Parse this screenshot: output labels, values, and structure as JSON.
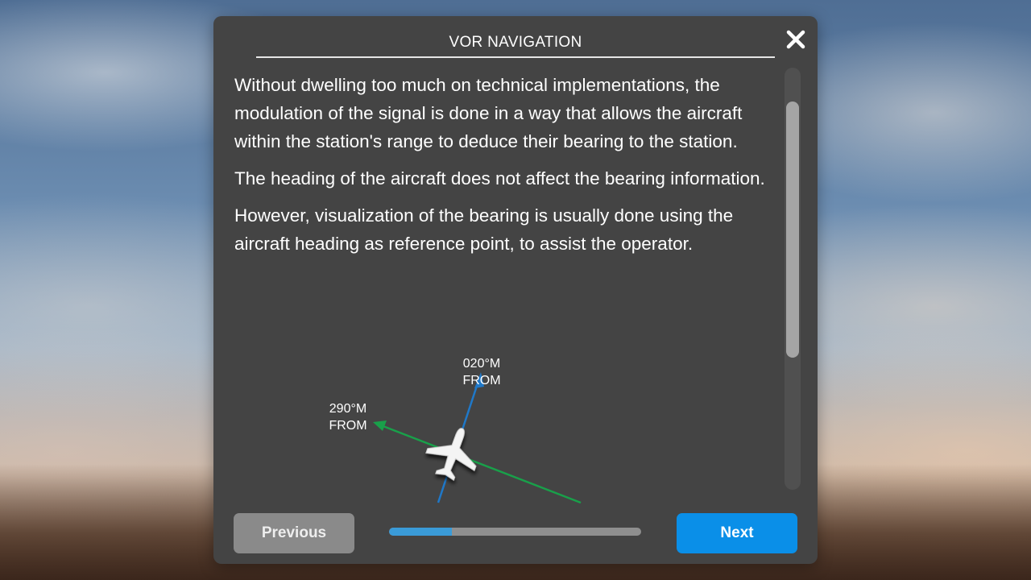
{
  "dialog": {
    "title": "VOR NAVIGATION",
    "close_icon": "close-icon"
  },
  "content": {
    "paragraphs": [
      "Without dwelling too much on technical implementations, the modulation of the signal is done in a way that allows the aircraft within the station's range to deduce their bearing to the station.",
      "The heading of the aircraft does not affect the bearing information.",
      "However, visualization of the bearing is usually done using the aircraft heading as reference point, to assist the operator."
    ],
    "diagram": {
      "label_blue_line1": "020°M",
      "label_blue_line2": "FROM",
      "label_green_line1": "290°M",
      "label_green_line2": "FROM",
      "colors": {
        "blue": "#1f78c8",
        "green": "#19a04a"
      },
      "icon": "airplane-icon"
    }
  },
  "footer": {
    "previous_label": "Previous",
    "next_label": "Next",
    "progress_percent": 25
  }
}
